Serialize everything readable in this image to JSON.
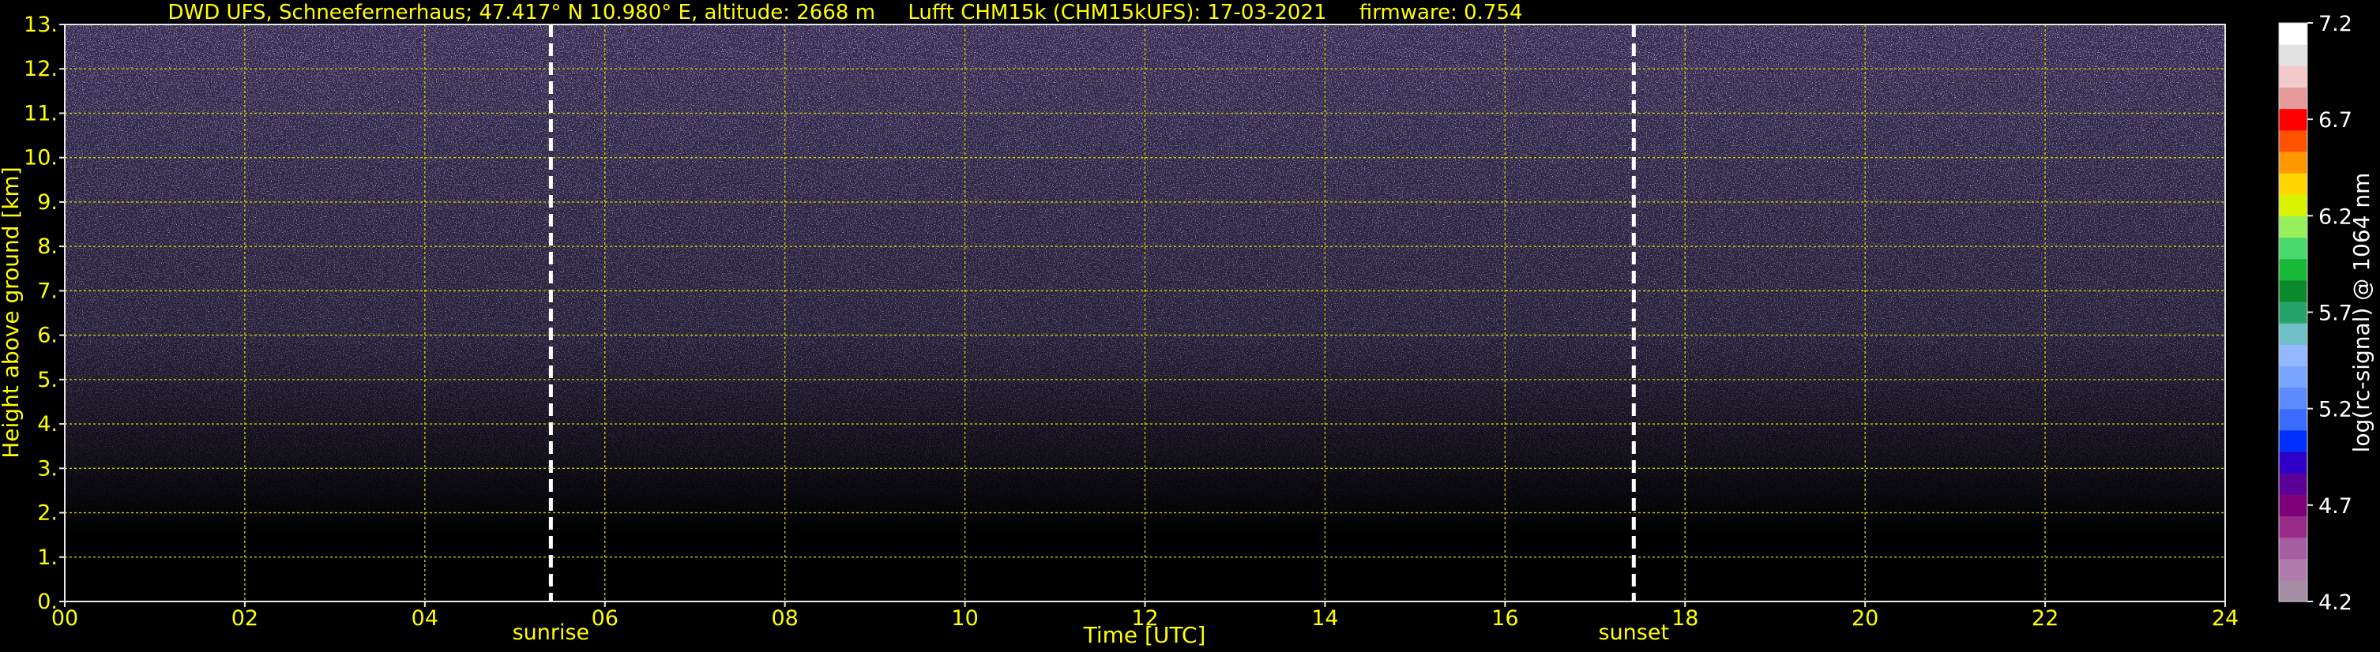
{
  "chart_data": {
    "type": "heatmap",
    "title": "DWD UFS, Schneefernerhaus; 47.417° N 10.980° E, altitude: 2668 m     Lufft CHM15k (CHM15kUFS): 17-03-2021     firmware: 0.754",
    "xlabel": "Time [UTC]",
    "ylabel": "Height above ground [km]",
    "xlim": [
      0,
      24
    ],
    "ylim": [
      0,
      13
    ],
    "x_ticks": [
      "00",
      "02",
      "04",
      "06",
      "08",
      "10",
      "12",
      "14",
      "16",
      "18",
      "20",
      "22",
      "24"
    ],
    "y_ticks": [
      "0.",
      "1.",
      "2.",
      "3.",
      "4.",
      "5.",
      "6.",
      "7.",
      "8.",
      "9.",
      "10.",
      "11.",
      "12.",
      "13."
    ],
    "grid": true,
    "markers": [
      {
        "label": "sunrise",
        "time": 5.4
      },
      {
        "label": "sunset",
        "time": 17.43
      }
    ],
    "colorbar": {
      "label": "log(rc-signal) @ 1064 nm",
      "range": [
        4.2,
        7.2
      ],
      "ticks": [
        "7.2",
        "6.7",
        "6.2",
        "5.7",
        "5.2",
        "4.7",
        "4.2"
      ],
      "colors": [
        "#a58ea5",
        "#b07aaa",
        "#a75ea0",
        "#992c8a",
        "#7d0078",
        "#5a0098",
        "#2f00c8",
        "#0030ff",
        "#3b6cff",
        "#5c8cff",
        "#7aa5ff",
        "#94b8ff",
        "#6fc0c6",
        "#26a36a",
        "#0b8a2c",
        "#19b938",
        "#49d96d",
        "#98ef5c",
        "#d8f300",
        "#ffd600",
        "#ff9800",
        "#ff5200",
        "#ff0000",
        "#e79a9a",
        "#f2caca",
        "#e2e2e2",
        "#ffffff"
      ]
    },
    "signal": {
      "background": "#000000",
      "noise_color": "#6a5a9a",
      "onset_height_km": 1.5,
      "full_height_km": 6.0
    }
  }
}
